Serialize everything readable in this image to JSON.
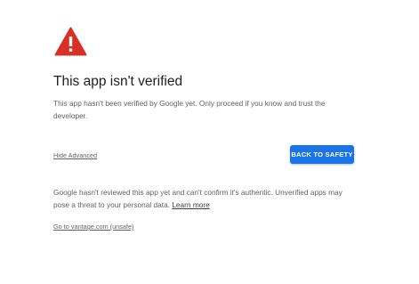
{
  "icon": {
    "name": "warning-triangle-icon",
    "color": "#d93025"
  },
  "title": "This app isn't verified",
  "description": "This app hasn't been verified by Google yet. Only proceed if you know and trust the developer.",
  "hide_advanced_label": "Hide Advanced",
  "back_to_safety_label": "BACK TO SAFETY",
  "advanced": {
    "text": "Google hasn't reviewed this app yet and can't confirm it's authentic. Unverified apps may pose a threat to your personal data.",
    "learn_more_label": "Learn more"
  },
  "unsafe_link_label": "Go to vantage.com (unsafe)",
  "colors": {
    "accent": "#1a73e8",
    "warning": "#d93025",
    "text_primary": "#202124",
    "text_secondary": "#5f6368"
  }
}
